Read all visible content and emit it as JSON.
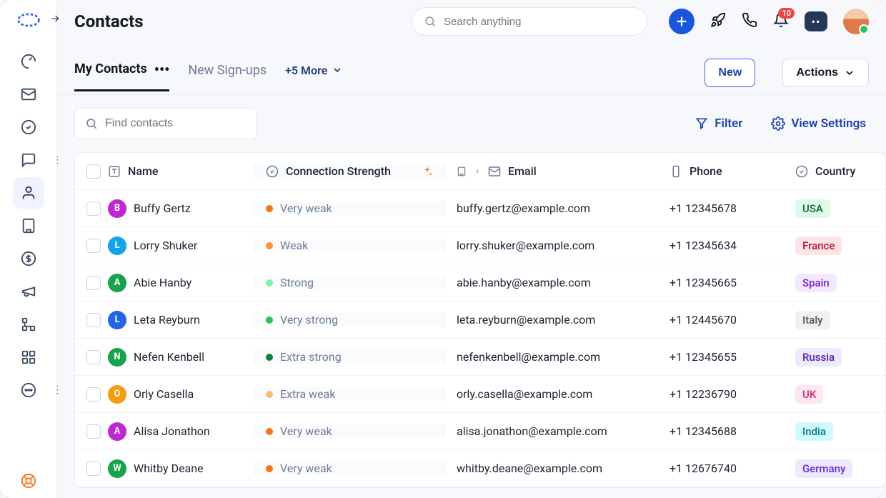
{
  "header": {
    "title": "Contacts",
    "search_placeholder": "Search anything",
    "notifications_count": "10"
  },
  "tabs": {
    "active": "My Contacts",
    "second": "New Sign-ups",
    "more": "+5 More"
  },
  "buttons": {
    "new": "New",
    "actions": "Actions"
  },
  "toolbar": {
    "find_placeholder": "Find contacts",
    "filter": "Filter",
    "view_settings": "View Settings"
  },
  "columns": {
    "name": "Name",
    "strength": "Connection Strength",
    "email": "Email",
    "phone": "Phone",
    "country": "Country"
  },
  "rows": [
    {
      "initial": "B",
      "avatar_bg": "#c026d3",
      "name": "Buffy Gertz",
      "strength": "Very weak",
      "dot": "#f97316",
      "email": "buffy.gertz@example.com",
      "phone": "+1 12345678",
      "country": "USA",
      "cbg": "#dcfce7",
      "cfg": "#166534"
    },
    {
      "initial": "L",
      "avatar_bg": "#0ea5e9",
      "name": "Lorry Shuker",
      "strength": "Weak",
      "dot": "#fb923c",
      "email": "lorry.shuker@example.com",
      "phone": "+1 12345634",
      "country": "France",
      "cbg": "#ffe4e6",
      "cfg": "#be123c"
    },
    {
      "initial": "A",
      "avatar_bg": "#16a34a",
      "name": "Abie Hanby",
      "strength": "Strong",
      "dot": "#86efac",
      "email": "abie.hanby@example.com",
      "phone": "+1 12345665",
      "country": "Spain",
      "cbg": "#f3e8ff",
      "cfg": "#7e22ce"
    },
    {
      "initial": "L",
      "avatar_bg": "#2563eb",
      "name": "Leta Reyburn",
      "strength": "Very strong",
      "dot": "#22c55e",
      "email": "leta.reyburn@example.com",
      "phone": "+1 12445670",
      "country": "Italy",
      "cbg": "#f1f1f0",
      "cfg": "#57534e"
    },
    {
      "initial": "N",
      "avatar_bg": "#16a34a",
      "name": "Nefen Kenbell",
      "strength": "Extra strong",
      "dot": "#15803d",
      "email": "nefenkenbell@example.com",
      "phone": "+1 12345655",
      "country": "Russia",
      "cbg": "#ede9fe",
      "cfg": "#5b21b6"
    },
    {
      "initial": "O",
      "avatar_bg": "#f59e0b",
      "name": "Orly Casella",
      "strength": "Extra weak",
      "dot": "#fdba74",
      "email": "orly.casella@example.com",
      "phone": "+1 12236790",
      "country": "UK",
      "cbg": "#fce7f3",
      "cfg": "#db2777"
    },
    {
      "initial": "A",
      "avatar_bg": "#c026d3",
      "name": "Alisa Jonathon",
      "strength": "Very weak",
      "dot": "#f97316",
      "email": "alisa.jonathon@example.com",
      "phone": "+1 12345688",
      "country": "India",
      "cbg": "#cffafe",
      "cfg": "#0e7490"
    },
    {
      "initial": "W",
      "avatar_bg": "#16a34a",
      "name": "Whitby Deane",
      "strength": "Very weak",
      "dot": "#f97316",
      "email": "whitby.deane@example.com",
      "phone": "+1 12676740",
      "country": "Germany",
      "cbg": "#ede9fe",
      "cfg": "#6d28d9"
    }
  ]
}
